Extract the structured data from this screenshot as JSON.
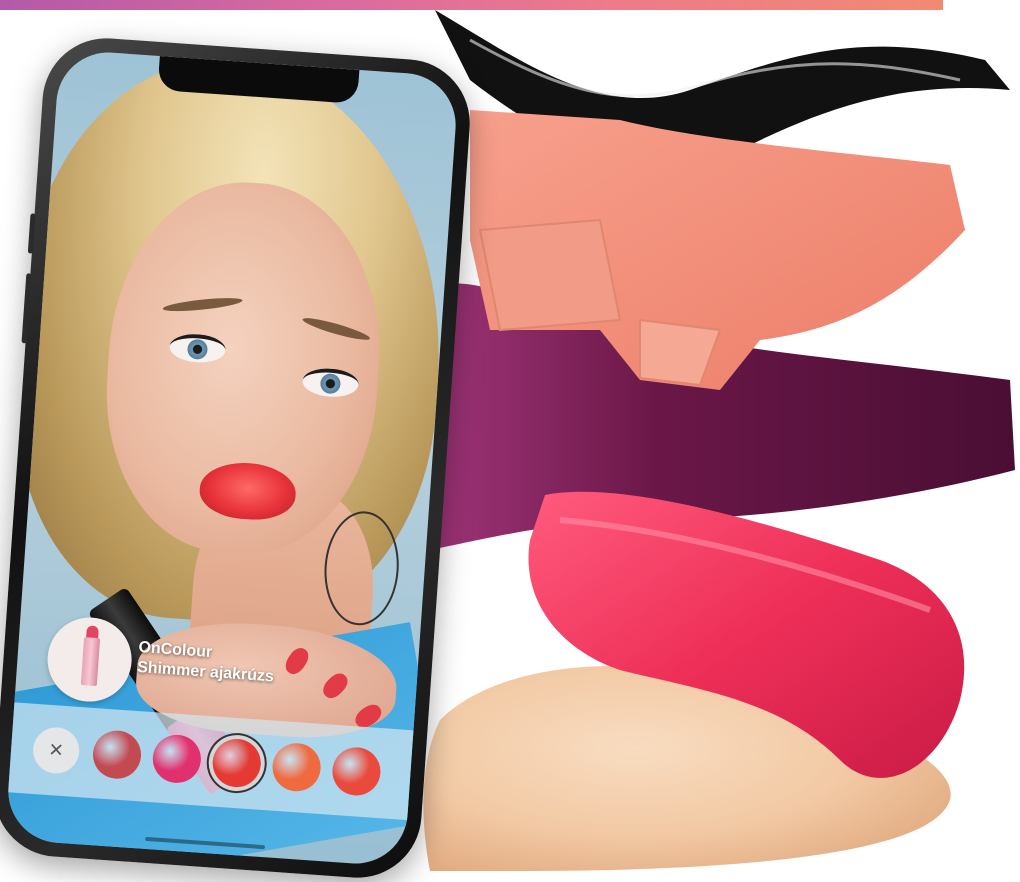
{
  "banner": {
    "gradient_start": "#b35aa8",
    "gradient_end": "#f28a72"
  },
  "product": {
    "name_line1": "OnColour",
    "name_line2": "Shimmer ajakrúzs",
    "thumb_icon": "lipstick-icon"
  },
  "picker": {
    "close_glyph": "×",
    "close_icon": "close-icon",
    "shades": [
      {
        "name": "shade-1",
        "color": "#c44a52",
        "selected": false
      },
      {
        "name": "shade-2",
        "color": "#e0306e",
        "selected": false
      },
      {
        "name": "shade-3",
        "color": "#e53a33",
        "selected": true
      },
      {
        "name": "shade-4",
        "color": "#f06a40",
        "selected": false
      },
      {
        "name": "shade-5",
        "color": "#ea4a3c",
        "selected": false
      }
    ]
  },
  "swatches": {
    "mascara_color": "#111111",
    "blush_color": "#f08a78",
    "plum_color": "#6a1747",
    "pink_lipstick_color": "#ee2f58",
    "foundation_color": "#f2c9a4"
  }
}
